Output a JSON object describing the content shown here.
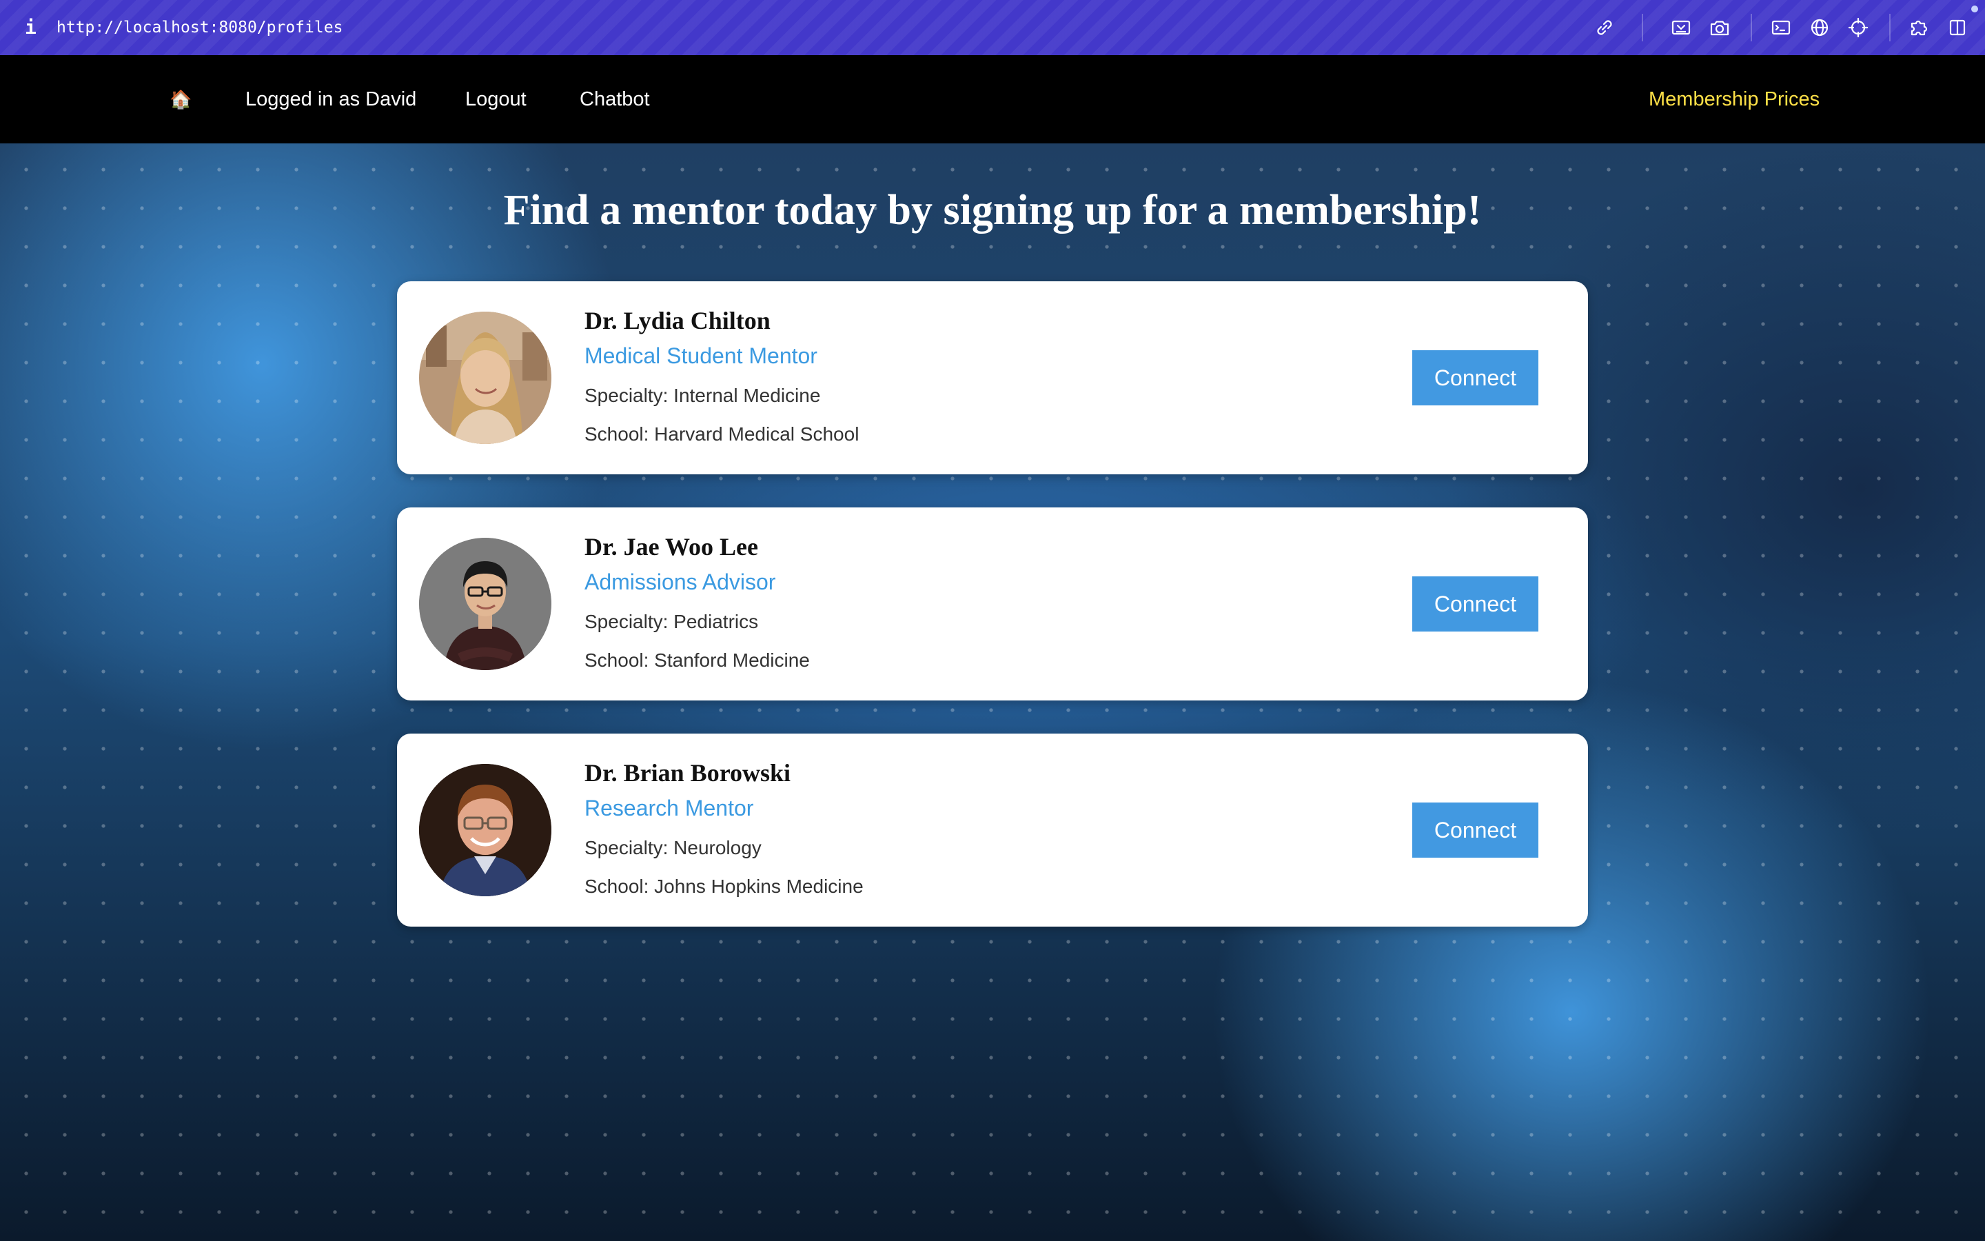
{
  "browser": {
    "info_icon": "i",
    "url": "http://localhost:8080/profiles",
    "icons": [
      "link-icon",
      "tab-capture-icon",
      "camera-icon",
      "terminal-icon",
      "globe-icon",
      "crosshair-icon",
      "puzzle-icon",
      "split-view-icon"
    ]
  },
  "nav": {
    "home_icon": "🏠",
    "logged_in": "Logged in as David",
    "logout": "Logout",
    "chatbot": "Chatbot",
    "membership_prices": "Membership Prices"
  },
  "page": {
    "title": "Find a mentor today by signing up for a membership!"
  },
  "mentors": [
    {
      "name": "Dr. Lydia Chilton",
      "role": "Medical Student Mentor",
      "specialty": "Specialty: Internal Medicine",
      "school": "School: Harvard Medical School",
      "connect_label": "Connect"
    },
    {
      "name": "Dr. Jae Woo Lee",
      "role": "Admissions Advisor",
      "specialty": "Specialty: Pediatrics",
      "school": "School: Stanford Medicine",
      "connect_label": "Connect"
    },
    {
      "name": "Dr. Brian Borowski",
      "role": "Research Mentor",
      "specialty": "Specialty: Neurology",
      "school": "School: Johns Hopkins Medicine",
      "connect_label": "Connect"
    }
  ],
  "colors": {
    "browser_bar": "#4338ca",
    "nav_background": "#000000",
    "membership_link": "#fde047",
    "role_text": "#3b9ae1",
    "connect_button": "#4299e1"
  }
}
